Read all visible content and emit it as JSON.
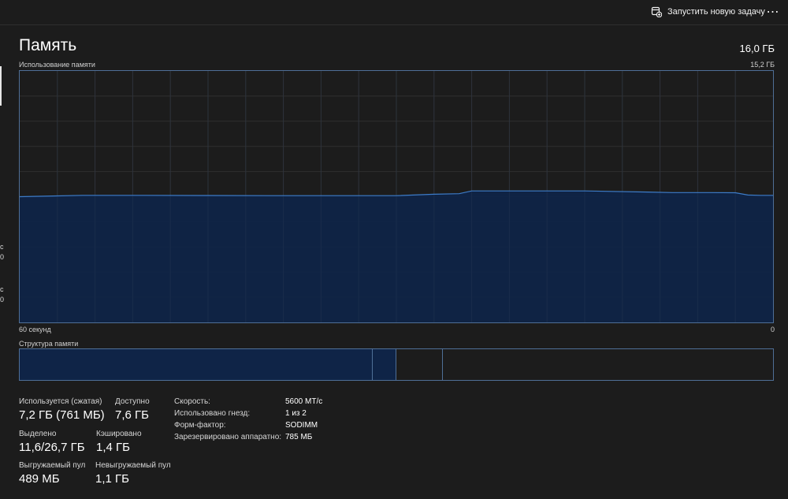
{
  "toolbar": {
    "run_task_label": "Запустить новую задачу",
    "run_task_icon": "new-task-icon",
    "more_icon": "more-icon",
    "more_glyph": "⋯"
  },
  "side_fragments": [
    {
      "text": "с"
    },
    {
      "text": "0"
    },
    {
      "text": "с"
    },
    {
      "text": "0"
    }
  ],
  "header": {
    "title": "Память",
    "total": "16,0 ГБ"
  },
  "chart_labels": {
    "usage": "Использование памяти",
    "max": "15,2 ГБ",
    "x_left": "60 секунд",
    "x_right": "0"
  },
  "chart_data": {
    "type": "area",
    "title": "Использование памяти",
    "xlabel": "",
    "ylabel": "",
    "xlim": [
      60,
      0
    ],
    "ylim": [
      0,
      15.2
    ],
    "grid": true,
    "x": [
      60,
      57,
      55,
      50,
      45,
      40,
      35,
      30,
      27,
      25,
      24,
      23,
      22,
      20,
      15,
      10,
      8,
      7,
      5,
      3,
      2,
      1,
      0
    ],
    "series": [
      {
        "values": [
          7.6,
          7.65,
          7.68,
          7.68,
          7.67,
          7.66,
          7.66,
          7.66,
          7.75,
          7.78,
          7.95,
          7.95,
          7.95,
          7.95,
          7.95,
          7.88,
          7.85,
          7.85,
          7.85,
          7.84,
          7.7,
          7.68,
          7.68
        ]
      }
    ],
    "colors": {
      "line": "#3d7cc9",
      "fill": "#0f2447"
    }
  },
  "structure": {
    "label": "Структура памяти",
    "segments": [
      {
        "name": "used",
        "fraction": 0.469,
        "fill": "#0f2447"
      },
      {
        "name": "modified",
        "fraction": 0.031,
        "fill": "#0f2447"
      },
      {
        "name": "standby",
        "fraction": 0.062,
        "fill": "#1c1c1c"
      },
      {
        "name": "free",
        "fraction": 0.438,
        "fill": "#1c1c1c"
      }
    ]
  },
  "stats": {
    "in_use_label": "Используется (сжатая)",
    "in_use_value": "7,2 ГБ (761 МБ)",
    "available_label": "Доступно",
    "available_value": "7,6 ГБ",
    "committed_label": "Выделено",
    "committed_value": "11,6/26,7 ГБ",
    "cached_label": "Кэшировано",
    "cached_value": "1,4 ГБ",
    "paged_label": "Выгружаемый пул",
    "paged_value": "489 МБ",
    "nonpaged_label": "Невыгружаемый пул",
    "nonpaged_value": "1,1 ГБ"
  },
  "hardware": {
    "speed_label": "Скорость:",
    "speed_value": "5600 МТ/с",
    "slots_label": "Использовано гнезд:",
    "slots_value": "1 из 2",
    "form_label": "Форм-фактор:",
    "form_value": "SODIMM",
    "reserved_label": "Зарезервировано аппаратно:",
    "reserved_value": "785 МБ"
  }
}
